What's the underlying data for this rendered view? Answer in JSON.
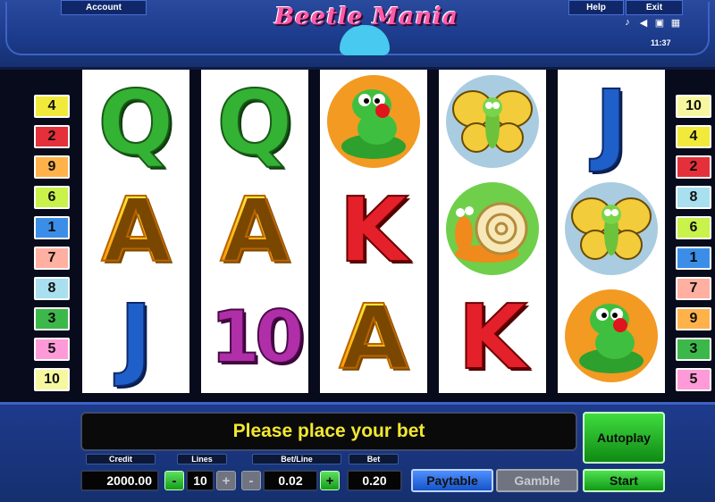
{
  "header": {
    "account_label": "Account",
    "help_label": "Help",
    "exit_label": "Exit",
    "logo_text": "Beetle Mania",
    "clock": "11:37",
    "icons": [
      "music-note-icon",
      "speaker-icon",
      "fullscreen-icon",
      "settings-icon"
    ]
  },
  "paylines": {
    "left": [
      {
        "num": "4",
        "color": "#f2ea3a"
      },
      {
        "num": "2",
        "color": "#e4303a"
      },
      {
        "num": "9",
        "color": "#ffb24a"
      },
      {
        "num": "6",
        "color": "#c9f24a"
      },
      {
        "num": "1",
        "color": "#3b8ee8"
      },
      {
        "num": "7",
        "color": "#ffb0a0"
      },
      {
        "num": "8",
        "color": "#a8e0f0"
      },
      {
        "num": "3",
        "color": "#3cb84a"
      },
      {
        "num": "5",
        "color": "#ff9ad8"
      },
      {
        "num": "10",
        "color": "#f7f7a0"
      }
    ],
    "right": [
      {
        "num": "10",
        "color": "#f7f7a0"
      },
      {
        "num": "4",
        "color": "#f2ea3a"
      },
      {
        "num": "2",
        "color": "#e4303a"
      },
      {
        "num": "8",
        "color": "#a8e0f0"
      },
      {
        "num": "6",
        "color": "#c9f24a"
      },
      {
        "num": "1",
        "color": "#3b8ee8"
      },
      {
        "num": "7",
        "color": "#ffb0a0"
      },
      {
        "num": "9",
        "color": "#ffb24a"
      },
      {
        "num": "3",
        "color": "#3cb84a"
      },
      {
        "num": "5",
        "color": "#ff9ad8"
      }
    ]
  },
  "reels": [
    [
      "Q",
      "A",
      "J"
    ],
    [
      "Q",
      "A",
      "10"
    ],
    [
      "caterpillar",
      "K",
      "A"
    ],
    [
      "butterfly",
      "snail",
      "K"
    ],
    [
      "J",
      "butterfly",
      "caterpillar"
    ]
  ],
  "panel": {
    "message": "Please place your bet",
    "autoplay_label": "Autoplay",
    "credit_label": "Credit",
    "credit_value": "2000.00",
    "lines_label": "Lines",
    "lines_value": "10",
    "betline_label": "Bet/Line",
    "betline_value": "0.02",
    "bet_label": "Bet",
    "bet_value": "0.20",
    "minus": "-",
    "plus": "+",
    "paytable_label": "Paytable",
    "gamble_label": "Gamble",
    "start_label": "Start"
  }
}
